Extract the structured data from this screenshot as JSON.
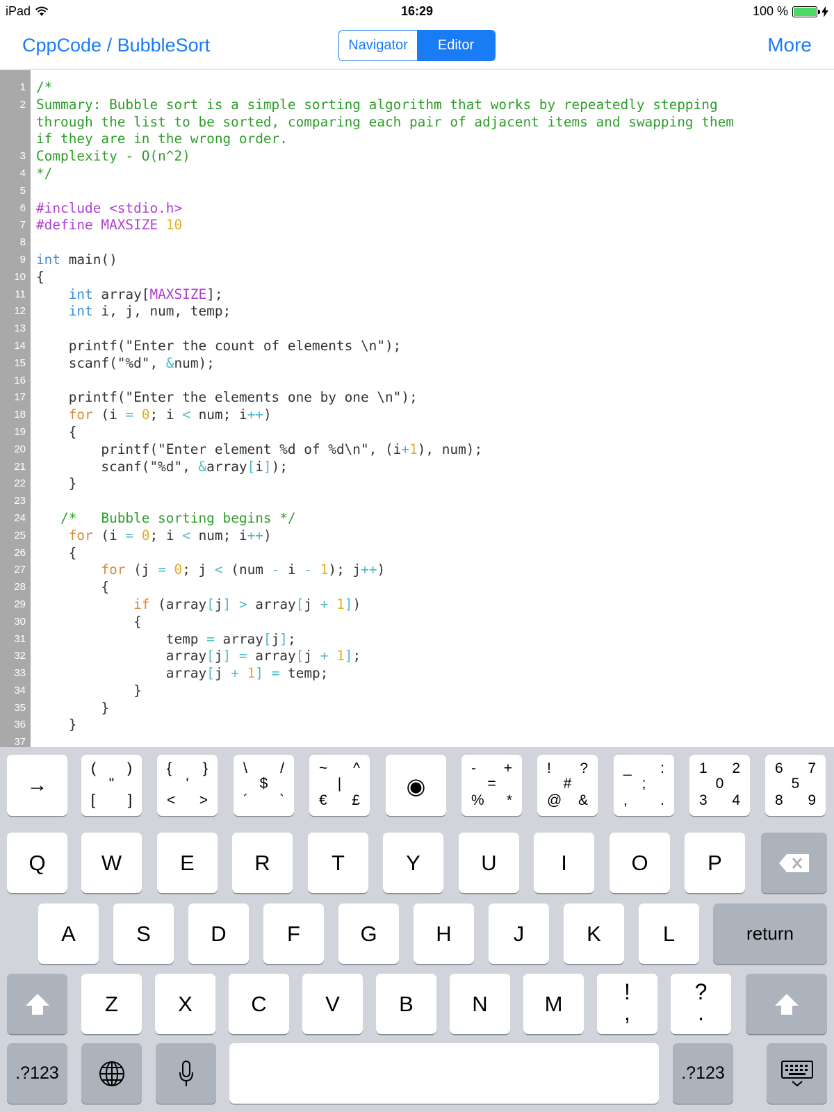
{
  "status_bar": {
    "device": "iPad",
    "time": "16:29",
    "battery": "100 %",
    "battery_level": 1.0
  },
  "nav": {
    "title": "CppCode / BubbleSort",
    "segments": [
      {
        "label": "Navigator",
        "active": false
      },
      {
        "label": "Editor",
        "active": true
      }
    ],
    "more": "More"
  },
  "editor": {
    "lines": [
      {
        "n": "1",
        "t": [
          [
            "cm",
            "/*"
          ]
        ]
      },
      {
        "n": "2",
        "t": [
          [
            "cm",
            "Summary: Bubble sort is a simple sorting algorithm that works by repeatedly stepping"
          ]
        ]
      },
      {
        "n": "",
        "t": [
          [
            "cm",
            "through the list to be sorted, comparing each pair of adjacent items and swapping them"
          ]
        ]
      },
      {
        "n": "",
        "t": [
          [
            "cm",
            "if they are in the wrong order."
          ]
        ]
      },
      {
        "n": "3",
        "t": [
          [
            "cm",
            "Complexity - O(n^2)"
          ]
        ]
      },
      {
        "n": "4",
        "t": [
          [
            "cm",
            "*/"
          ]
        ]
      },
      {
        "n": "5",
        "t": []
      },
      {
        "n": "6",
        "t": [
          [
            "pp",
            "#include <stdio.h>"
          ]
        ]
      },
      {
        "n": "7",
        "t": [
          [
            "pp",
            "#define MAXSIZE "
          ],
          [
            "num",
            "10"
          ]
        ]
      },
      {
        "n": "8",
        "t": []
      },
      {
        "n": "9",
        "t": [
          [
            "ty",
            "int"
          ],
          [
            "pl",
            " main()"
          ]
        ]
      },
      {
        "n": "10",
        "t": [
          [
            "pl",
            "{"
          ]
        ]
      },
      {
        "n": "11",
        "t": [
          [
            "pl",
            "    "
          ],
          [
            "ty",
            "int"
          ],
          [
            "pl",
            " array["
          ],
          [
            "pp",
            "MAXSIZE"
          ],
          [
            "pl",
            "];"
          ]
        ]
      },
      {
        "n": "12",
        "t": [
          [
            "pl",
            "    "
          ],
          [
            "ty",
            "int"
          ],
          [
            "pl",
            " i, j, num, temp;"
          ]
        ]
      },
      {
        "n": "13",
        "t": []
      },
      {
        "n": "14",
        "t": [
          [
            "pl",
            "    printf(\"Enter the count of elements \\n\");"
          ]
        ]
      },
      {
        "n": "15",
        "t": [
          [
            "pl",
            "    scanf(\"%d\", "
          ],
          [
            "op",
            "&"
          ],
          [
            "pl",
            "num);"
          ]
        ]
      },
      {
        "n": "16",
        "t": []
      },
      {
        "n": "17",
        "t": [
          [
            "pl",
            "    printf(\"Enter the elements one by one \\n\");"
          ]
        ]
      },
      {
        "n": "18",
        "t": [
          [
            "pl",
            "    "
          ],
          [
            "kw",
            "for"
          ],
          [
            "pl",
            " (i "
          ],
          [
            "op",
            "="
          ],
          [
            "pl",
            " "
          ],
          [
            "num",
            "0"
          ],
          [
            "pl",
            "; i "
          ],
          [
            "op",
            "<"
          ],
          [
            "pl",
            " num; i"
          ],
          [
            "op",
            "++"
          ],
          [
            "pl",
            ")"
          ]
        ]
      },
      {
        "n": "19",
        "t": [
          [
            "pl",
            "    {"
          ]
        ]
      },
      {
        "n": "20",
        "t": [
          [
            "pl",
            "        printf(\"Enter element %d of %d\\n\", (i"
          ],
          [
            "op",
            "+"
          ],
          [
            "num",
            "1"
          ],
          [
            "pl",
            "), num);"
          ]
        ]
      },
      {
        "n": "21",
        "t": [
          [
            "pl",
            "        scanf(\"%d\", "
          ],
          [
            "op",
            "&"
          ],
          [
            "pl",
            "array"
          ],
          [
            "op",
            "["
          ],
          [
            "pl",
            "i"
          ],
          [
            "op",
            "]"
          ],
          [
            "pl",
            ");"
          ]
        ]
      },
      {
        "n": "22",
        "t": [
          [
            "pl",
            "    }"
          ]
        ]
      },
      {
        "n": "23",
        "t": []
      },
      {
        "n": "24",
        "t": [
          [
            "pl",
            "   "
          ],
          [
            "cm",
            "/*   Bubble sorting begins */"
          ]
        ]
      },
      {
        "n": "25",
        "t": [
          [
            "pl",
            "    "
          ],
          [
            "kw",
            "for"
          ],
          [
            "pl",
            " (i "
          ],
          [
            "op",
            "="
          ],
          [
            "pl",
            " "
          ],
          [
            "num",
            "0"
          ],
          [
            "pl",
            "; i "
          ],
          [
            "op",
            "<"
          ],
          [
            "pl",
            " num; i"
          ],
          [
            "op",
            "++"
          ],
          [
            "pl",
            ")"
          ]
        ]
      },
      {
        "n": "26",
        "t": [
          [
            "pl",
            "    {"
          ]
        ]
      },
      {
        "n": "27",
        "t": [
          [
            "pl",
            "        "
          ],
          [
            "kw",
            "for"
          ],
          [
            "pl",
            " (j "
          ],
          [
            "op",
            "="
          ],
          [
            "pl",
            " "
          ],
          [
            "num",
            "0"
          ],
          [
            "pl",
            "; j "
          ],
          [
            "op",
            "<"
          ],
          [
            "pl",
            " (num "
          ],
          [
            "op",
            "-"
          ],
          [
            "pl",
            " i "
          ],
          [
            "op",
            "-"
          ],
          [
            "pl",
            " "
          ],
          [
            "num",
            "1"
          ],
          [
            "pl",
            "); j"
          ],
          [
            "op",
            "++"
          ],
          [
            "pl",
            ")"
          ]
        ]
      },
      {
        "n": "28",
        "t": [
          [
            "pl",
            "        {"
          ]
        ]
      },
      {
        "n": "29",
        "t": [
          [
            "pl",
            "            "
          ],
          [
            "kw",
            "if"
          ],
          [
            "pl",
            " (array"
          ],
          [
            "op",
            "["
          ],
          [
            "pl",
            "j"
          ],
          [
            "op",
            "]"
          ],
          [
            "pl",
            " "
          ],
          [
            "op",
            ">"
          ],
          [
            "pl",
            " array"
          ],
          [
            "op",
            "["
          ],
          [
            "pl",
            "j "
          ],
          [
            "op",
            "+"
          ],
          [
            "pl",
            " "
          ],
          [
            "num",
            "1"
          ],
          [
            "op",
            "]"
          ],
          [
            "pl",
            ")"
          ]
        ]
      },
      {
        "n": "30",
        "t": [
          [
            "pl",
            "            {"
          ]
        ]
      },
      {
        "n": "31",
        "t": [
          [
            "pl",
            "                temp "
          ],
          [
            "op",
            "="
          ],
          [
            "pl",
            " array"
          ],
          [
            "op",
            "["
          ],
          [
            "pl",
            "j"
          ],
          [
            "op",
            "]"
          ],
          [
            "pl",
            ";"
          ]
        ]
      },
      {
        "n": "32",
        "t": [
          [
            "pl",
            "                array"
          ],
          [
            "op",
            "["
          ],
          [
            "pl",
            "j"
          ],
          [
            "op",
            "]"
          ],
          [
            "pl",
            " "
          ],
          [
            "op",
            "="
          ],
          [
            "pl",
            " array"
          ],
          [
            "op",
            "["
          ],
          [
            "pl",
            "j "
          ],
          [
            "op",
            "+"
          ],
          [
            "pl",
            " "
          ],
          [
            "num",
            "1"
          ],
          [
            "op",
            "]"
          ],
          [
            "pl",
            ";"
          ]
        ]
      },
      {
        "n": "33",
        "t": [
          [
            "pl",
            "                array"
          ],
          [
            "op",
            "["
          ],
          [
            "pl",
            "j "
          ],
          [
            "op",
            "+"
          ],
          [
            "pl",
            " "
          ],
          [
            "num",
            "1"
          ],
          [
            "op",
            "]"
          ],
          [
            "pl",
            " "
          ],
          [
            "op",
            "="
          ],
          [
            "pl",
            " temp;"
          ]
        ]
      },
      {
        "n": "34",
        "t": [
          [
            "pl",
            "            }"
          ]
        ]
      },
      {
        "n": "35",
        "t": [
          [
            "pl",
            "        }"
          ]
        ]
      },
      {
        "n": "36",
        "t": [
          [
            "pl",
            "    }"
          ]
        ]
      },
      {
        "n": "37",
        "t": []
      }
    ]
  },
  "keyboard": {
    "symbol_row": {
      "tab": "→",
      "keys": [
        {
          "name": "paren-bracket-quote-key",
          "tl": "(",
          "tr": ")",
          "c": "\"",
          "bl": "[",
          "br": "]"
        },
        {
          "name": "brace-angle-key",
          "tl": "{",
          "tr": "}",
          "c": "'",
          "bl": "<",
          "br": ">"
        },
        {
          "name": "slash-dollar-key",
          "tl": "\\",
          "tr": "/",
          "c": "$",
          "bl": "´",
          "br": "`"
        },
        {
          "name": "tilde-caret-currency-key",
          "tl": "~",
          "tr": "^",
          "c": "|",
          "bl": "€",
          "br": "£"
        },
        {
          "name": "cursor-control-key",
          "c": "◉"
        },
        {
          "name": "operators-key",
          "tl": "-",
          "tr": "+",
          "c": "=",
          "bl": "%",
          "br": "*"
        },
        {
          "name": "punctuation-key",
          "tl": "!",
          "tr": "?",
          "c": "#",
          "bl": "@",
          "br": "&"
        },
        {
          "name": "separators-key",
          "tl": "_",
          "tr": ":",
          "c": ";",
          "bl": ",",
          "br": "."
        },
        {
          "name": "digits-0-4-key",
          "tl": "1",
          "tr": "2",
          "c": "0",
          "bl": "3",
          "br": "4"
        },
        {
          "name": "digits-5-9-key",
          "tl": "6",
          "tr": "7",
          "c": "5",
          "bl": "8",
          "br": "9"
        }
      ]
    },
    "row1": [
      "Q",
      "W",
      "E",
      "R",
      "T",
      "Y",
      "U",
      "I",
      "O",
      "P"
    ],
    "row2": [
      "A",
      "S",
      "D",
      "F",
      "G",
      "H",
      "J",
      "K",
      "L"
    ],
    "row3": [
      "Z",
      "X",
      "C",
      "V",
      "B",
      "N",
      "M"
    ],
    "row3_punct": [
      {
        "top": "!",
        "bottom": ","
      },
      {
        "top": "?",
        "bottom": "."
      }
    ],
    "return_label": "return",
    "numbers_label": ".?123",
    "icons": {
      "backspace": "backspace-icon",
      "shift": "shift-icon",
      "globe": "globe-icon",
      "mic": "microphone-icon",
      "hide": "hide-keyboard-icon"
    }
  }
}
